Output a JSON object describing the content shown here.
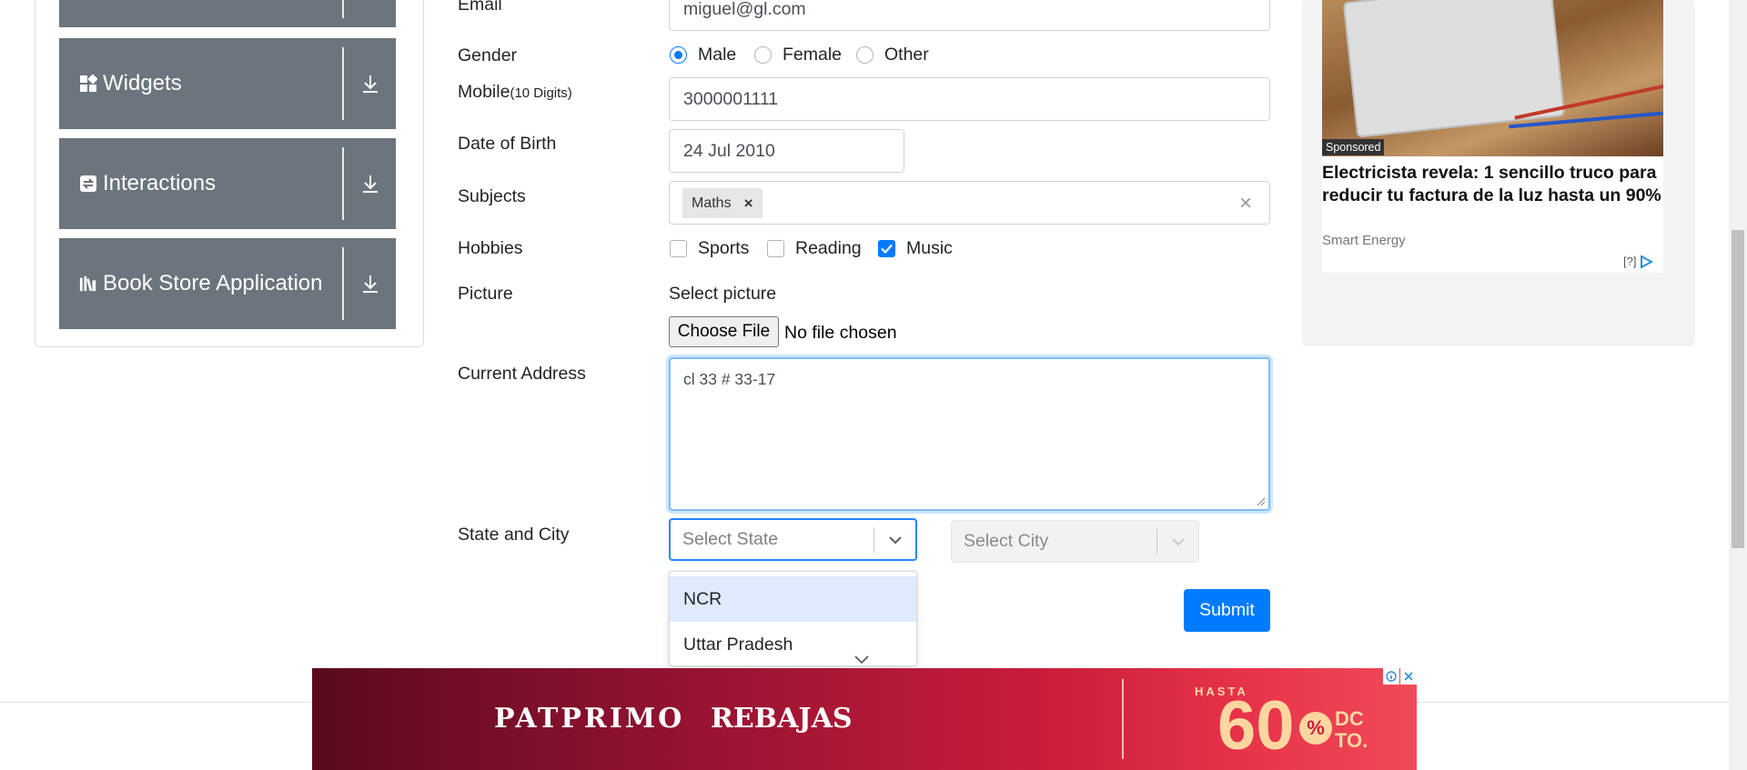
{
  "sidebar": {
    "groups": [
      {
        "label": "Widgets",
        "icon": "widgets-icon"
      },
      {
        "label": "Interactions",
        "icon": "interactions-icon"
      },
      {
        "label": "Book Store Application",
        "icon": "bookstore-icon"
      }
    ]
  },
  "form": {
    "email": {
      "label": "Email",
      "value": "miguel@gl.com"
    },
    "gender": {
      "label": "Gender",
      "options": [
        "Male",
        "Female",
        "Other"
      ],
      "selected": "Male"
    },
    "mobile": {
      "label": "Mobile",
      "hint": "(10 Digits)",
      "value": "3000001111"
    },
    "dob": {
      "label": "Date of Birth",
      "value": "24 Jul 2010"
    },
    "subjects": {
      "label": "Subjects",
      "chips": [
        "Maths"
      ],
      "remove_glyph": "×",
      "clear_glyph": "×"
    },
    "hobbies": {
      "label": "Hobbies",
      "options": [
        "Sports",
        "Reading",
        "Music"
      ],
      "checked": [
        "Music"
      ]
    },
    "picture": {
      "label": "Picture",
      "select_label": "Select picture",
      "button": "Choose File",
      "status": "No file chosen"
    },
    "address": {
      "label": "Current Address",
      "value": "cl 33 # 33-17"
    },
    "state_city": {
      "label": "State and City",
      "state_placeholder": "Select State",
      "city_placeholder": "Select City",
      "state_options": [
        "NCR",
        "Uttar Pradesh"
      ]
    },
    "submit": "Submit"
  },
  "ad_right": {
    "badge": "Sponsored",
    "headline": "Electricista revela: 1 sencillo truco para reducir tu factura de la luz hasta un 90%",
    "brand": "Smart Energy",
    "info": "[?]"
  },
  "banner": {
    "brand": "PATPRIMO",
    "sale": "REBAJAS",
    "hasta": "HASTA",
    "amount": "60",
    "pct": "%",
    "dcto_1": "DC",
    "dcto_2": "TO."
  },
  "colors": {
    "accent": "#007bff",
    "sidebar": "#6c757d"
  }
}
